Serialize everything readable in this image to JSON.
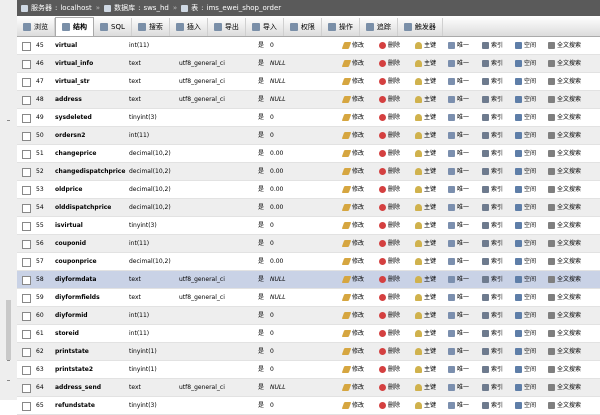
{
  "breadcrumb": {
    "server_label": "服务器",
    "server": "localhost",
    "db_label": "数据库",
    "db": "sws_hd",
    "table_label": "表",
    "table": "ims_ewei_shop_order"
  },
  "tabs": [
    {
      "label": "浏览",
      "icon": "browse-icon",
      "active": false
    },
    {
      "label": "结构",
      "icon": "structure-icon",
      "active": true
    },
    {
      "label": "SQL",
      "icon": "sql-icon",
      "active": false
    },
    {
      "label": "搜索",
      "icon": "search-icon",
      "active": false
    },
    {
      "label": "插入",
      "icon": "insert-icon",
      "active": false
    },
    {
      "label": "导出",
      "icon": "export-icon",
      "active": false
    },
    {
      "label": "导入",
      "icon": "import-icon",
      "active": false
    },
    {
      "label": "权限",
      "icon": "privileges-icon",
      "active": false
    },
    {
      "label": "操作",
      "icon": "operations-icon",
      "active": false
    },
    {
      "label": "追踪",
      "icon": "tracking-icon",
      "active": false
    },
    {
      "label": "触发器",
      "icon": "triggers-icon",
      "active": false
    }
  ],
  "actions": {
    "edit": "修改",
    "drop": "删除",
    "primary": "主键",
    "unique": "唯一",
    "index": "索引",
    "spatial": "空间",
    "fulltext": "全文搜索"
  },
  "rows": [
    {
      "num": "45",
      "name": "virtual",
      "type": "int(11)",
      "collation": "",
      "null": "是",
      "default": "0"
    },
    {
      "num": "46",
      "name": "virtual_info",
      "type": "text",
      "collation": "utf8_general_ci",
      "null": "是",
      "default": "NULL"
    },
    {
      "num": "47",
      "name": "virtual_str",
      "type": "text",
      "collation": "utf8_general_ci",
      "null": "是",
      "default": "NULL"
    },
    {
      "num": "48",
      "name": "address",
      "type": "text",
      "collation": "utf8_general_ci",
      "null": "是",
      "default": "NULL"
    },
    {
      "num": "49",
      "name": "sysdeleted",
      "type": "tinyint(3)",
      "collation": "",
      "null": "是",
      "default": "0"
    },
    {
      "num": "50",
      "name": "ordersn2",
      "type": "int(11)",
      "collation": "",
      "null": "是",
      "default": "0"
    },
    {
      "num": "51",
      "name": "changeprice",
      "type": "decimal(10,2)",
      "collation": "",
      "null": "是",
      "default": "0.00"
    },
    {
      "num": "52",
      "name": "changedispatchprice",
      "type": "decimal(10,2)",
      "collation": "",
      "null": "是",
      "default": "0.00"
    },
    {
      "num": "53",
      "name": "oldprice",
      "type": "decimal(10,2)",
      "collation": "",
      "null": "是",
      "default": "0.00"
    },
    {
      "num": "54",
      "name": "olddispatchprice",
      "type": "decimal(10,2)",
      "collation": "",
      "null": "是",
      "default": "0.00"
    },
    {
      "num": "55",
      "name": "isvirtual",
      "type": "tinyint(3)",
      "collation": "",
      "null": "是",
      "default": "0"
    },
    {
      "num": "56",
      "name": "couponid",
      "type": "int(11)",
      "collation": "",
      "null": "是",
      "default": "0"
    },
    {
      "num": "57",
      "name": "couponprice",
      "type": "decimal(10,2)",
      "collation": "",
      "null": "是",
      "default": "0.00"
    },
    {
      "num": "58",
      "name": "diyformdata",
      "type": "text",
      "collation": "utf8_general_ci",
      "null": "是",
      "default": "NULL"
    },
    {
      "num": "59",
      "name": "diyformfields",
      "type": "text",
      "collation": "utf8_general_ci",
      "null": "是",
      "default": "NULL"
    },
    {
      "num": "60",
      "name": "diyformid",
      "type": "int(11)",
      "collation": "",
      "null": "是",
      "default": "0"
    },
    {
      "num": "61",
      "name": "storeid",
      "type": "int(11)",
      "collation": "",
      "null": "是",
      "default": "0"
    },
    {
      "num": "62",
      "name": "printstate",
      "type": "tinyint(1)",
      "collation": "",
      "null": "是",
      "default": "0"
    },
    {
      "num": "63",
      "name": "printstate2",
      "type": "tinyint(1)",
      "collation": "",
      "null": "是",
      "default": "0"
    },
    {
      "num": "64",
      "name": "address_send",
      "type": "text",
      "collation": "utf8_general_ci",
      "null": "是",
      "default": "NULL"
    },
    {
      "num": "65",
      "name": "refundstate",
      "type": "tinyint(3)",
      "collation": "",
      "null": "是",
      "default": "0"
    }
  ],
  "highlight_row_index": 13
}
